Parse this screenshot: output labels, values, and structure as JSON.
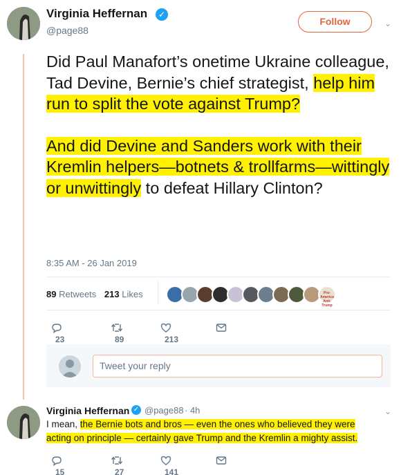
{
  "tweet": {
    "author": {
      "name": "Virginia Heffernan",
      "handle": "@page88"
    },
    "follow_label": "Follow",
    "paragraph1": {
      "plain": "Did Paul Manafort’s onetime Ukraine colleague, Tad Devine, Bernie’s chief strategist, ",
      "highlight": "help him run to split the vote against Trump?"
    },
    "paragraph2": {
      "highlight": "And did Devine and Sanders work with their Kremlin helpers—botnets & trollfarms—wittingly or unwittingly",
      "plain": " to defeat Hillary Clinton?"
    },
    "timestamp": "8:35 AM - 26 Jan 2019",
    "stats": {
      "retweets_count": "89",
      "retweets_label": "Retweets",
      "likes_count": "213",
      "likes_label": "Likes"
    },
    "actions": {
      "replies": "23",
      "retweets": "89",
      "likes": "213"
    }
  },
  "reply_box": {
    "placeholder": "Tweet your reply"
  },
  "reply": {
    "author": {
      "name": "Virginia Heffernan",
      "handle": "@page88",
      "time": "· 4h"
    },
    "text_plain": "I mean, ",
    "text_highlight": "the Bernie bots and bros — even the ones who believed they were acting on principle — certainly gave Trump and the Kremlin a mighty assist.",
    "actions": {
      "replies": "15",
      "retweets": "27",
      "likes": "141"
    }
  },
  "colors": {
    "highlight": "#fff100",
    "follow_accent": "#e1653a",
    "verified": "#1da1f2",
    "thread_line": "#f0c4a8",
    "liker_avatars": [
      "#3b6ea8",
      "#9aa4ad",
      "#5a3d2e",
      "#2d2d2d",
      "#c9c2d6",
      "#555a60",
      "#6b7f8e",
      "#7c6a55",
      "#4d5a3c",
      "#b79a7c",
      "#e8e1d4"
    ]
  },
  "liker_badge": {
    "line1": "Pro-America",
    "line2": "Anti-Trump"
  },
  "icons": [
    "verified-badge-icon",
    "chevron-down-icon",
    "reply-icon",
    "retweet-icon",
    "like-icon",
    "message-icon"
  ]
}
